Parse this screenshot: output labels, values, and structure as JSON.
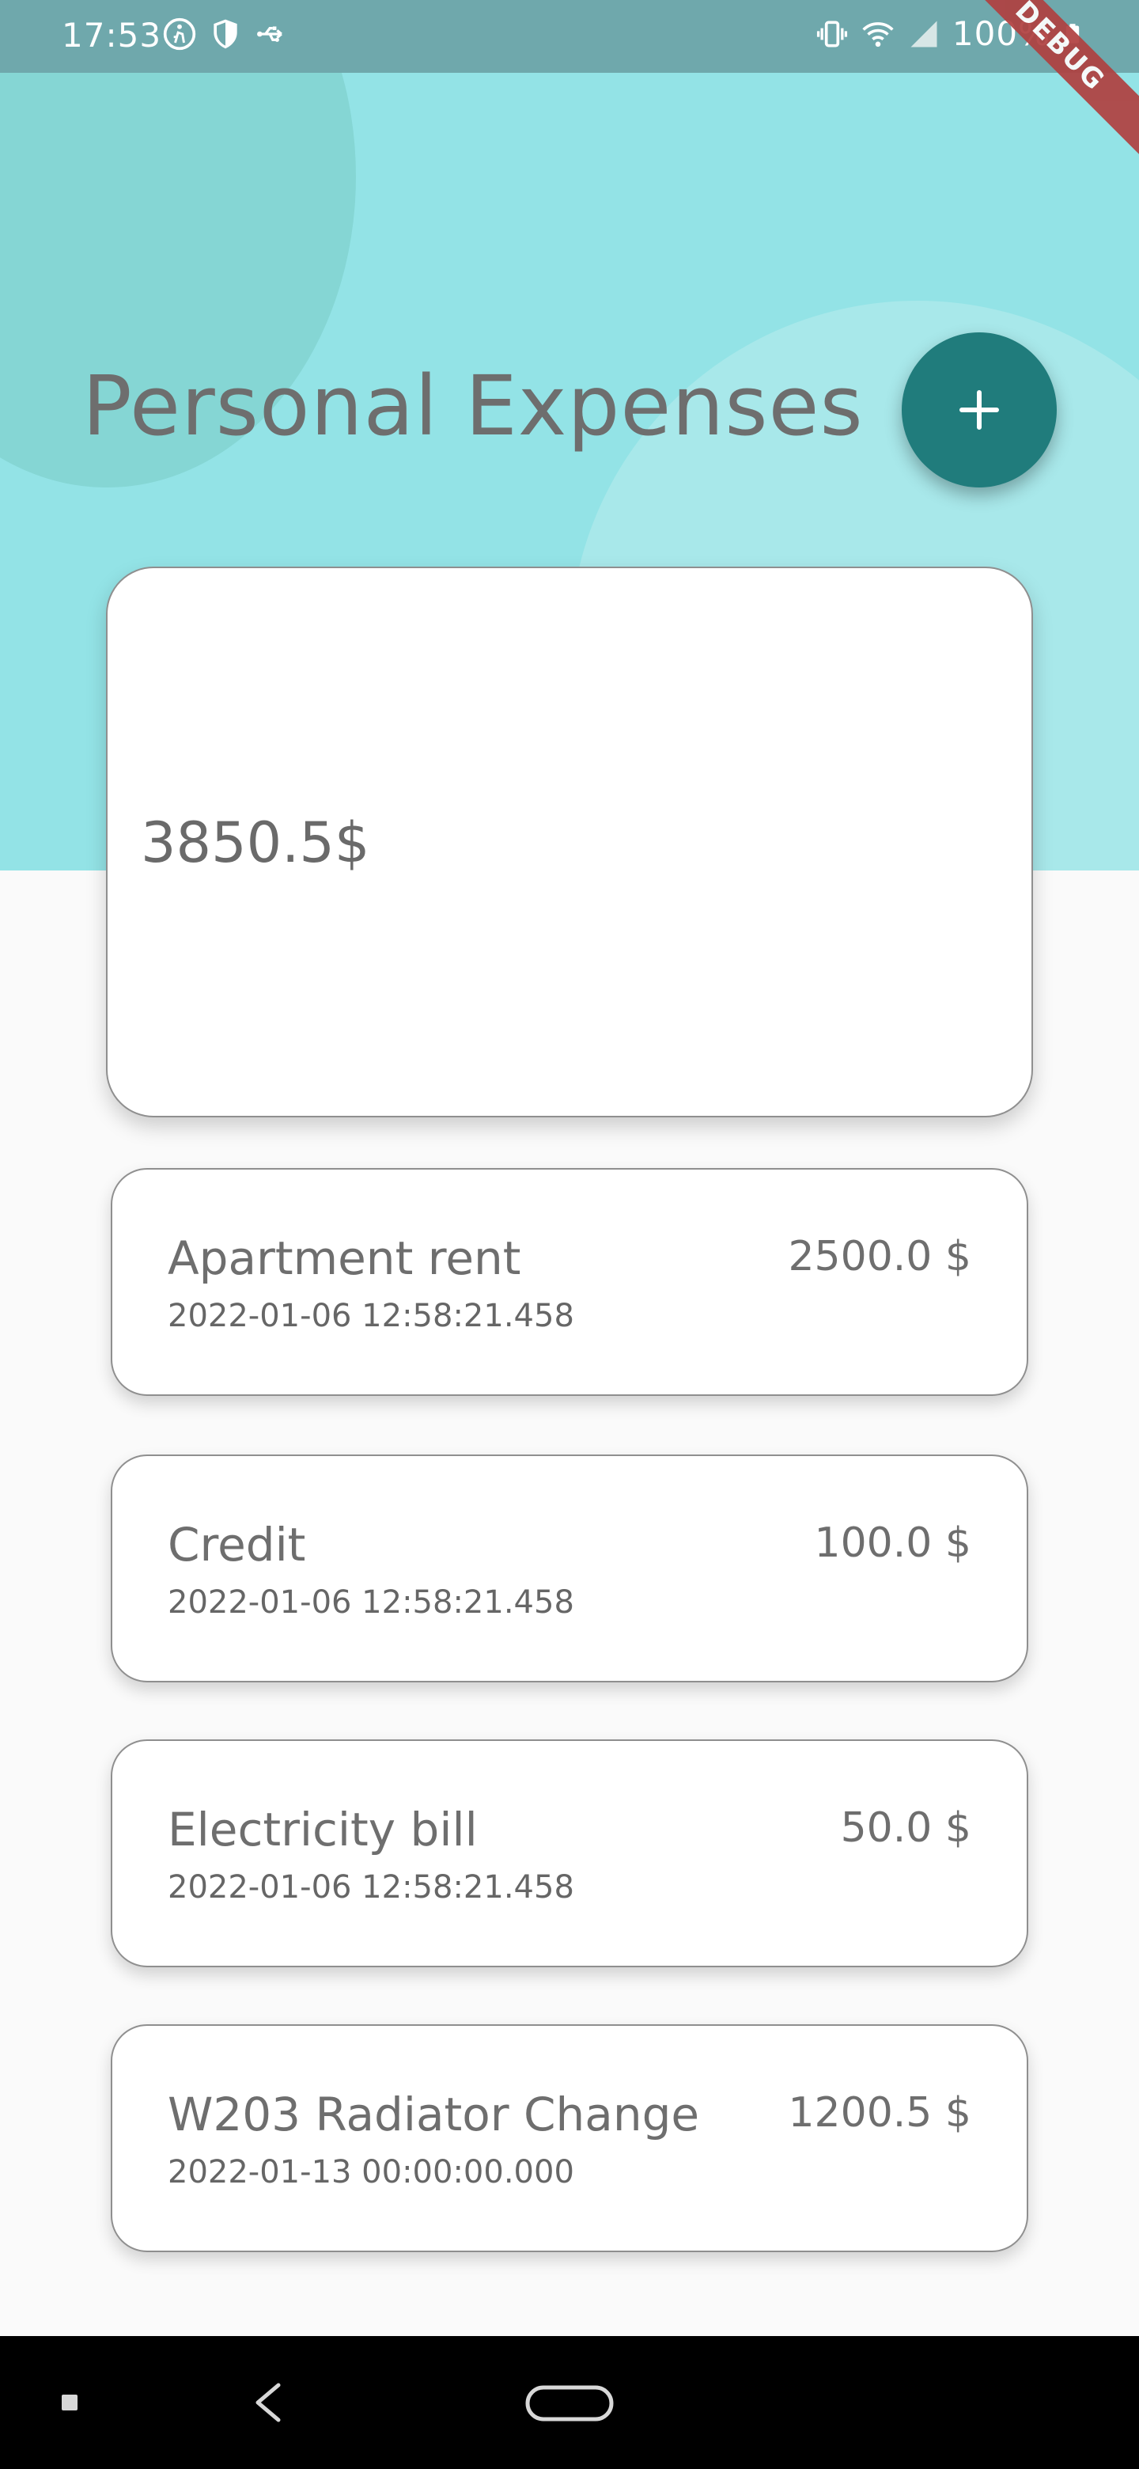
{
  "status_bar": {
    "time": "17:53",
    "left_icons": [
      "accessibility-icon",
      "shield-icon",
      "usb-icon"
    ],
    "right_icons": [
      "vibrate-icon",
      "wifi-icon",
      "signal-icon",
      "battery-icon"
    ],
    "battery": "100%"
  },
  "debug_banner": "DEBUG",
  "header": {
    "title": "Personal Expenses",
    "add_icon": "plus-icon"
  },
  "summary": {
    "total": "3850.5$"
  },
  "expenses": [
    {
      "name": "Apartment rent",
      "date": "2022-01-06 12:58:21.458",
      "amount": "2500.0 $"
    },
    {
      "name": "Credit",
      "date": "2022-01-06 12:58:21.458",
      "amount": "100.0 $"
    },
    {
      "name": "Electricity bill",
      "date": "2022-01-06 12:58:21.458",
      "amount": "50.0 $"
    },
    {
      "name": "W203 Radiator Change",
      "date": "2022-01-13 00:00:00.000",
      "amount": "1200.5 $"
    }
  ],
  "nav": {
    "icons": [
      "recents-icon",
      "back-icon",
      "home-icon"
    ]
  },
  "colors": {
    "hero_background": "#93e3e6",
    "fab": "#207c7c",
    "page_background": "#fafafa"
  }
}
